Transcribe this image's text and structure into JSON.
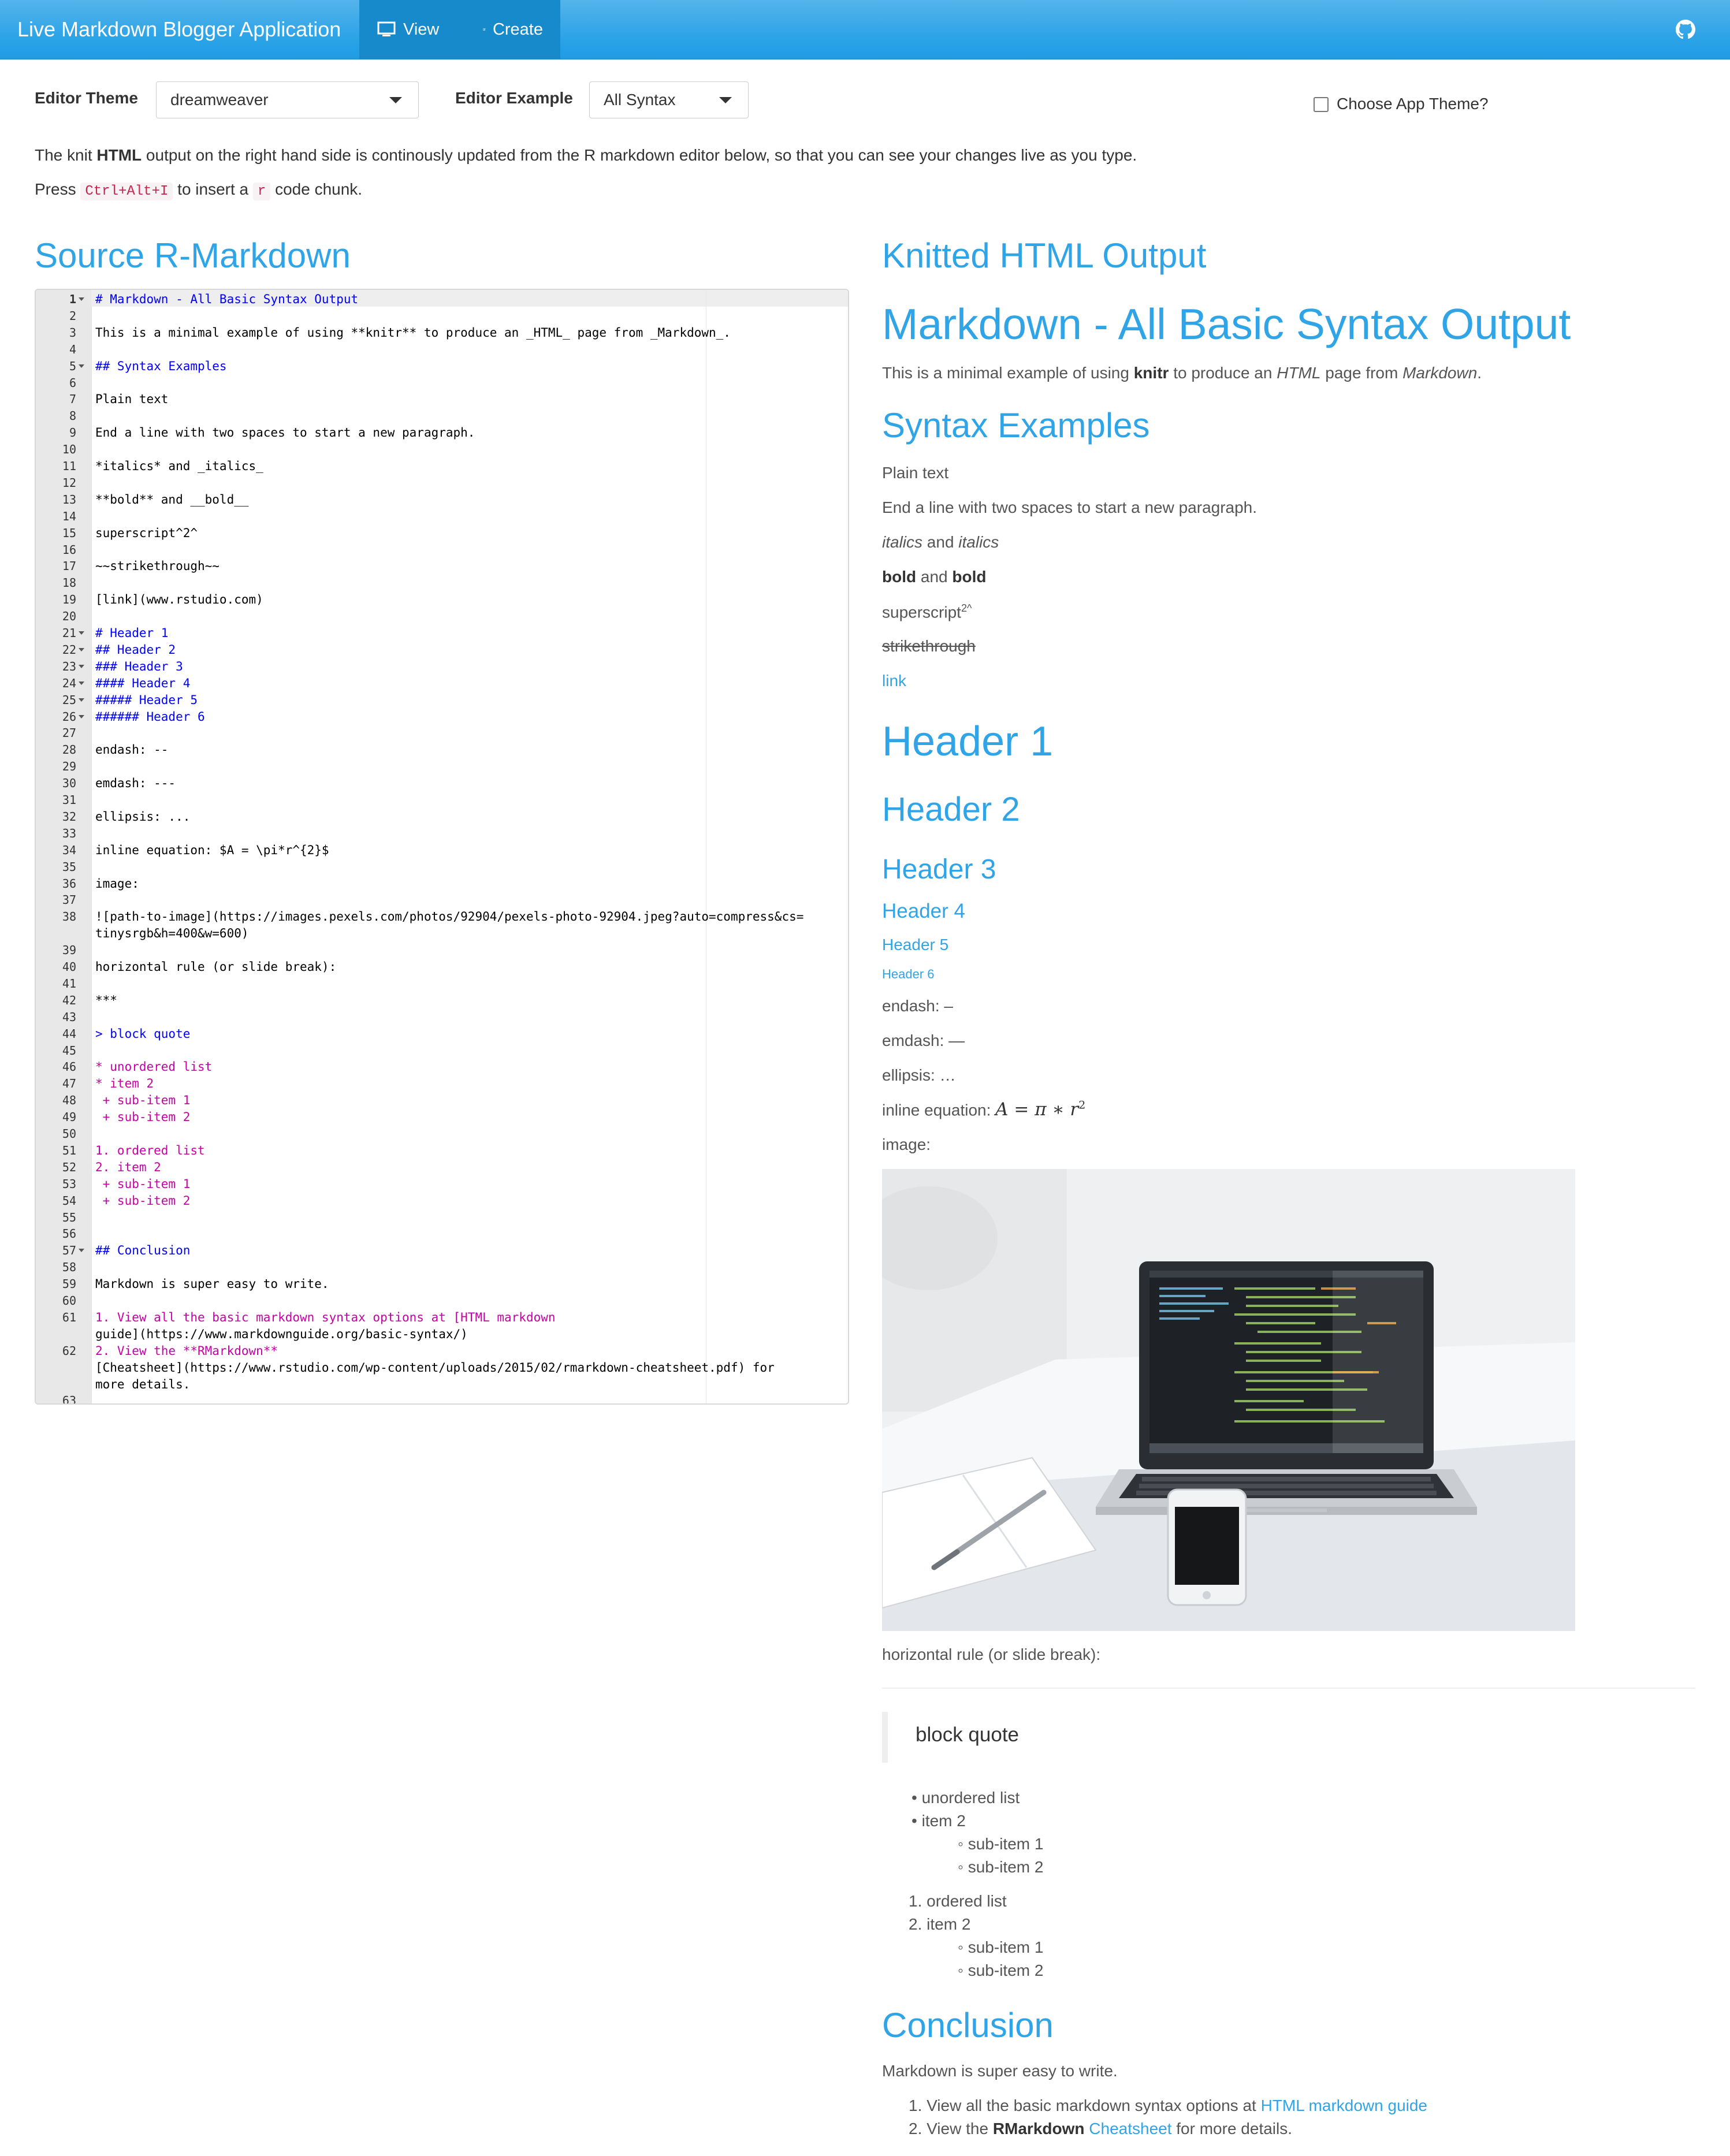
{
  "navbar": {
    "brand": "Live Markdown Blogger Application",
    "tabs": [
      {
        "label": "View",
        "icon": "monitor-icon"
      },
      {
        "label": "Create",
        "icon": "edit-icon"
      }
    ],
    "github_icon": "github-icon"
  },
  "controls": {
    "editor_theme_label": "Editor Theme",
    "editor_theme_value": "dreamweaver",
    "editor_example_label": "Editor Example",
    "editor_example_value": "All Syntax",
    "app_theme_label": "Choose App Theme?"
  },
  "intro": {
    "line1_a": "The knit ",
    "line1_b": "HTML",
    "line1_c": " output on the right hand side is continously updated from the R markdown editor below, so that you can see your changes live as you type.",
    "line2_a": "Press ",
    "line2_key": "Ctrl+Alt+I",
    "line2_b": " to insert a ",
    "line2_r": "r",
    "line2_c": " code chunk."
  },
  "source_title": "Source R-Markdown",
  "output_title": "Knitted HTML Output",
  "editor": {
    "lines": [
      {
        "n": "1",
        "t": "# Markdown - All Basic Syntax Output"
      },
      {
        "n": "2",
        "t": ""
      },
      {
        "n": "3",
        "t": "This is a minimal example of using **knitr** to produce an _HTML_ page from _Markdown_."
      },
      {
        "n": "4",
        "t": ""
      },
      {
        "n": "5",
        "t": "## Syntax Examples"
      },
      {
        "n": "6",
        "t": ""
      },
      {
        "n": "7",
        "t": "Plain text"
      },
      {
        "n": "8",
        "t": ""
      },
      {
        "n": "9",
        "t": "End a line with two spaces to start a new paragraph."
      },
      {
        "n": "10",
        "t": ""
      },
      {
        "n": "11",
        "t": "*italics* and _italics_"
      },
      {
        "n": "12",
        "t": ""
      },
      {
        "n": "13",
        "t": "**bold** and __bold__"
      },
      {
        "n": "14",
        "t": ""
      },
      {
        "n": "15",
        "t": "superscript^2^"
      },
      {
        "n": "16",
        "t": ""
      },
      {
        "n": "17",
        "t": "~~strikethrough~~"
      },
      {
        "n": "18",
        "t": ""
      },
      {
        "n": "19",
        "t": "[link](www.rstudio.com)"
      },
      {
        "n": "20",
        "t": ""
      },
      {
        "n": "21",
        "t": "# Header 1"
      },
      {
        "n": "22",
        "t": "## Header 2"
      },
      {
        "n": "23",
        "t": "### Header 3"
      },
      {
        "n": "24",
        "t": "#### Header 4"
      },
      {
        "n": "25",
        "t": "##### Header 5"
      },
      {
        "n": "26",
        "t": "###### Header 6"
      },
      {
        "n": "27",
        "t": ""
      },
      {
        "n": "28",
        "t": "endash: --"
      },
      {
        "n": "29",
        "t": ""
      },
      {
        "n": "30",
        "t": "emdash: ---"
      },
      {
        "n": "31",
        "t": ""
      },
      {
        "n": "32",
        "t": "ellipsis: ..."
      },
      {
        "n": "33",
        "t": ""
      },
      {
        "n": "34",
        "t": "inline equation: $A = \\pi*r^{2}$"
      },
      {
        "n": "35",
        "t": ""
      },
      {
        "n": "36",
        "t": "image:"
      },
      {
        "n": "37",
        "t": ""
      },
      {
        "n": "38",
        "t": "![path-to-image](https://images.pexels.com/photos/92904/pexels-photo-92904.jpeg?auto=compress&cs="
      },
      {
        "n": "",
        "t": "tinysrgb&h=400&w=600)"
      },
      {
        "n": "39",
        "t": ""
      },
      {
        "n": "40",
        "t": "horizontal rule (or slide break):"
      },
      {
        "n": "41",
        "t": ""
      },
      {
        "n": "42",
        "t": "***"
      },
      {
        "n": "43",
        "t": ""
      },
      {
        "n": "44",
        "t": "> block quote"
      },
      {
        "n": "45",
        "t": ""
      },
      {
        "n": "46",
        "t": "* unordered list"
      },
      {
        "n": "47",
        "t": "* item 2"
      },
      {
        "n": "48",
        "t": " + sub-item 1"
      },
      {
        "n": "49",
        "t": " + sub-item 2"
      },
      {
        "n": "50",
        "t": ""
      },
      {
        "n": "51",
        "t": "1. ordered list"
      },
      {
        "n": "52",
        "t": "2. item 2"
      },
      {
        "n": "53",
        "t": " + sub-item 1"
      },
      {
        "n": "54",
        "t": " + sub-item 2"
      },
      {
        "n": "55",
        "t": ""
      },
      {
        "n": "56",
        "t": ""
      },
      {
        "n": "57",
        "t": "## Conclusion"
      },
      {
        "n": "58",
        "t": ""
      },
      {
        "n": "59",
        "t": "Markdown is super easy to write."
      },
      {
        "n": "60",
        "t": ""
      },
      {
        "n": "61",
        "t": "1. View all the basic markdown syntax options at [HTML markdown"
      },
      {
        "n": "",
        "t": "guide](https://www.markdownguide.org/basic-syntax/)"
      },
      {
        "n": "62",
        "t": "2. View the **RMarkdown**"
      },
      {
        "n": "",
        "t": "[Cheatsheet](https://www.rstudio.com/wp-content/uploads/2015/02/rmarkdown-cheatsheet.pdf) for"
      },
      {
        "n": "",
        "t": "more details."
      },
      {
        "n": "63",
        "t": ""
      }
    ]
  },
  "output": {
    "h1": "Markdown - All Basic Syntax Output",
    "intro_a": "This is a minimal example of using ",
    "intro_b": "knitr",
    "intro_c": " to produce an ",
    "intro_d": "HTML",
    "intro_e": " page from ",
    "intro_f": "Markdown",
    "intro_g": ".",
    "syntax_h": "Syntax Examples",
    "plain": "Plain text",
    "paragraph": "End a line with two spaces to start a new paragraph.",
    "italics_a": "italics",
    "italics_b": " and ",
    "italics_c": "italics",
    "bold_a": "bold",
    "bold_b": " and ",
    "bold_c": "bold",
    "superscript": "superscript",
    "superscript_sup": "2^",
    "strike": "strikethrough",
    "link": "link",
    "headers": [
      "Header 1",
      "Header 2",
      "Header 3",
      "Header 4",
      "Header 5",
      "Header 6"
    ],
    "endash": "endash: –",
    "emdash": "emdash: —",
    "ellipsis": "ellipsis: …",
    "equation_label": "inline equation: ",
    "image_label": "image:",
    "hr_label": "horizontal rule (or slide break):",
    "blockquote": "block quote",
    "ul": [
      "unordered list",
      "item 2"
    ],
    "ul_sub": [
      "sub-item 1",
      "sub-item 2"
    ],
    "ol": [
      "ordered list",
      "item 2"
    ],
    "ol_sub": [
      "sub-item 1",
      "sub-item 2"
    ],
    "conclusion_h": "Conclusion",
    "conclusion_text": "Markdown is super easy to write.",
    "final1_a": "View all the basic markdown syntax options at ",
    "final1_link": "HTML markdown guide",
    "final2_a": "View the ",
    "final2_b": "RMarkdown",
    "final2_link": "Cheatsheet",
    "final2_c": " for more details."
  }
}
